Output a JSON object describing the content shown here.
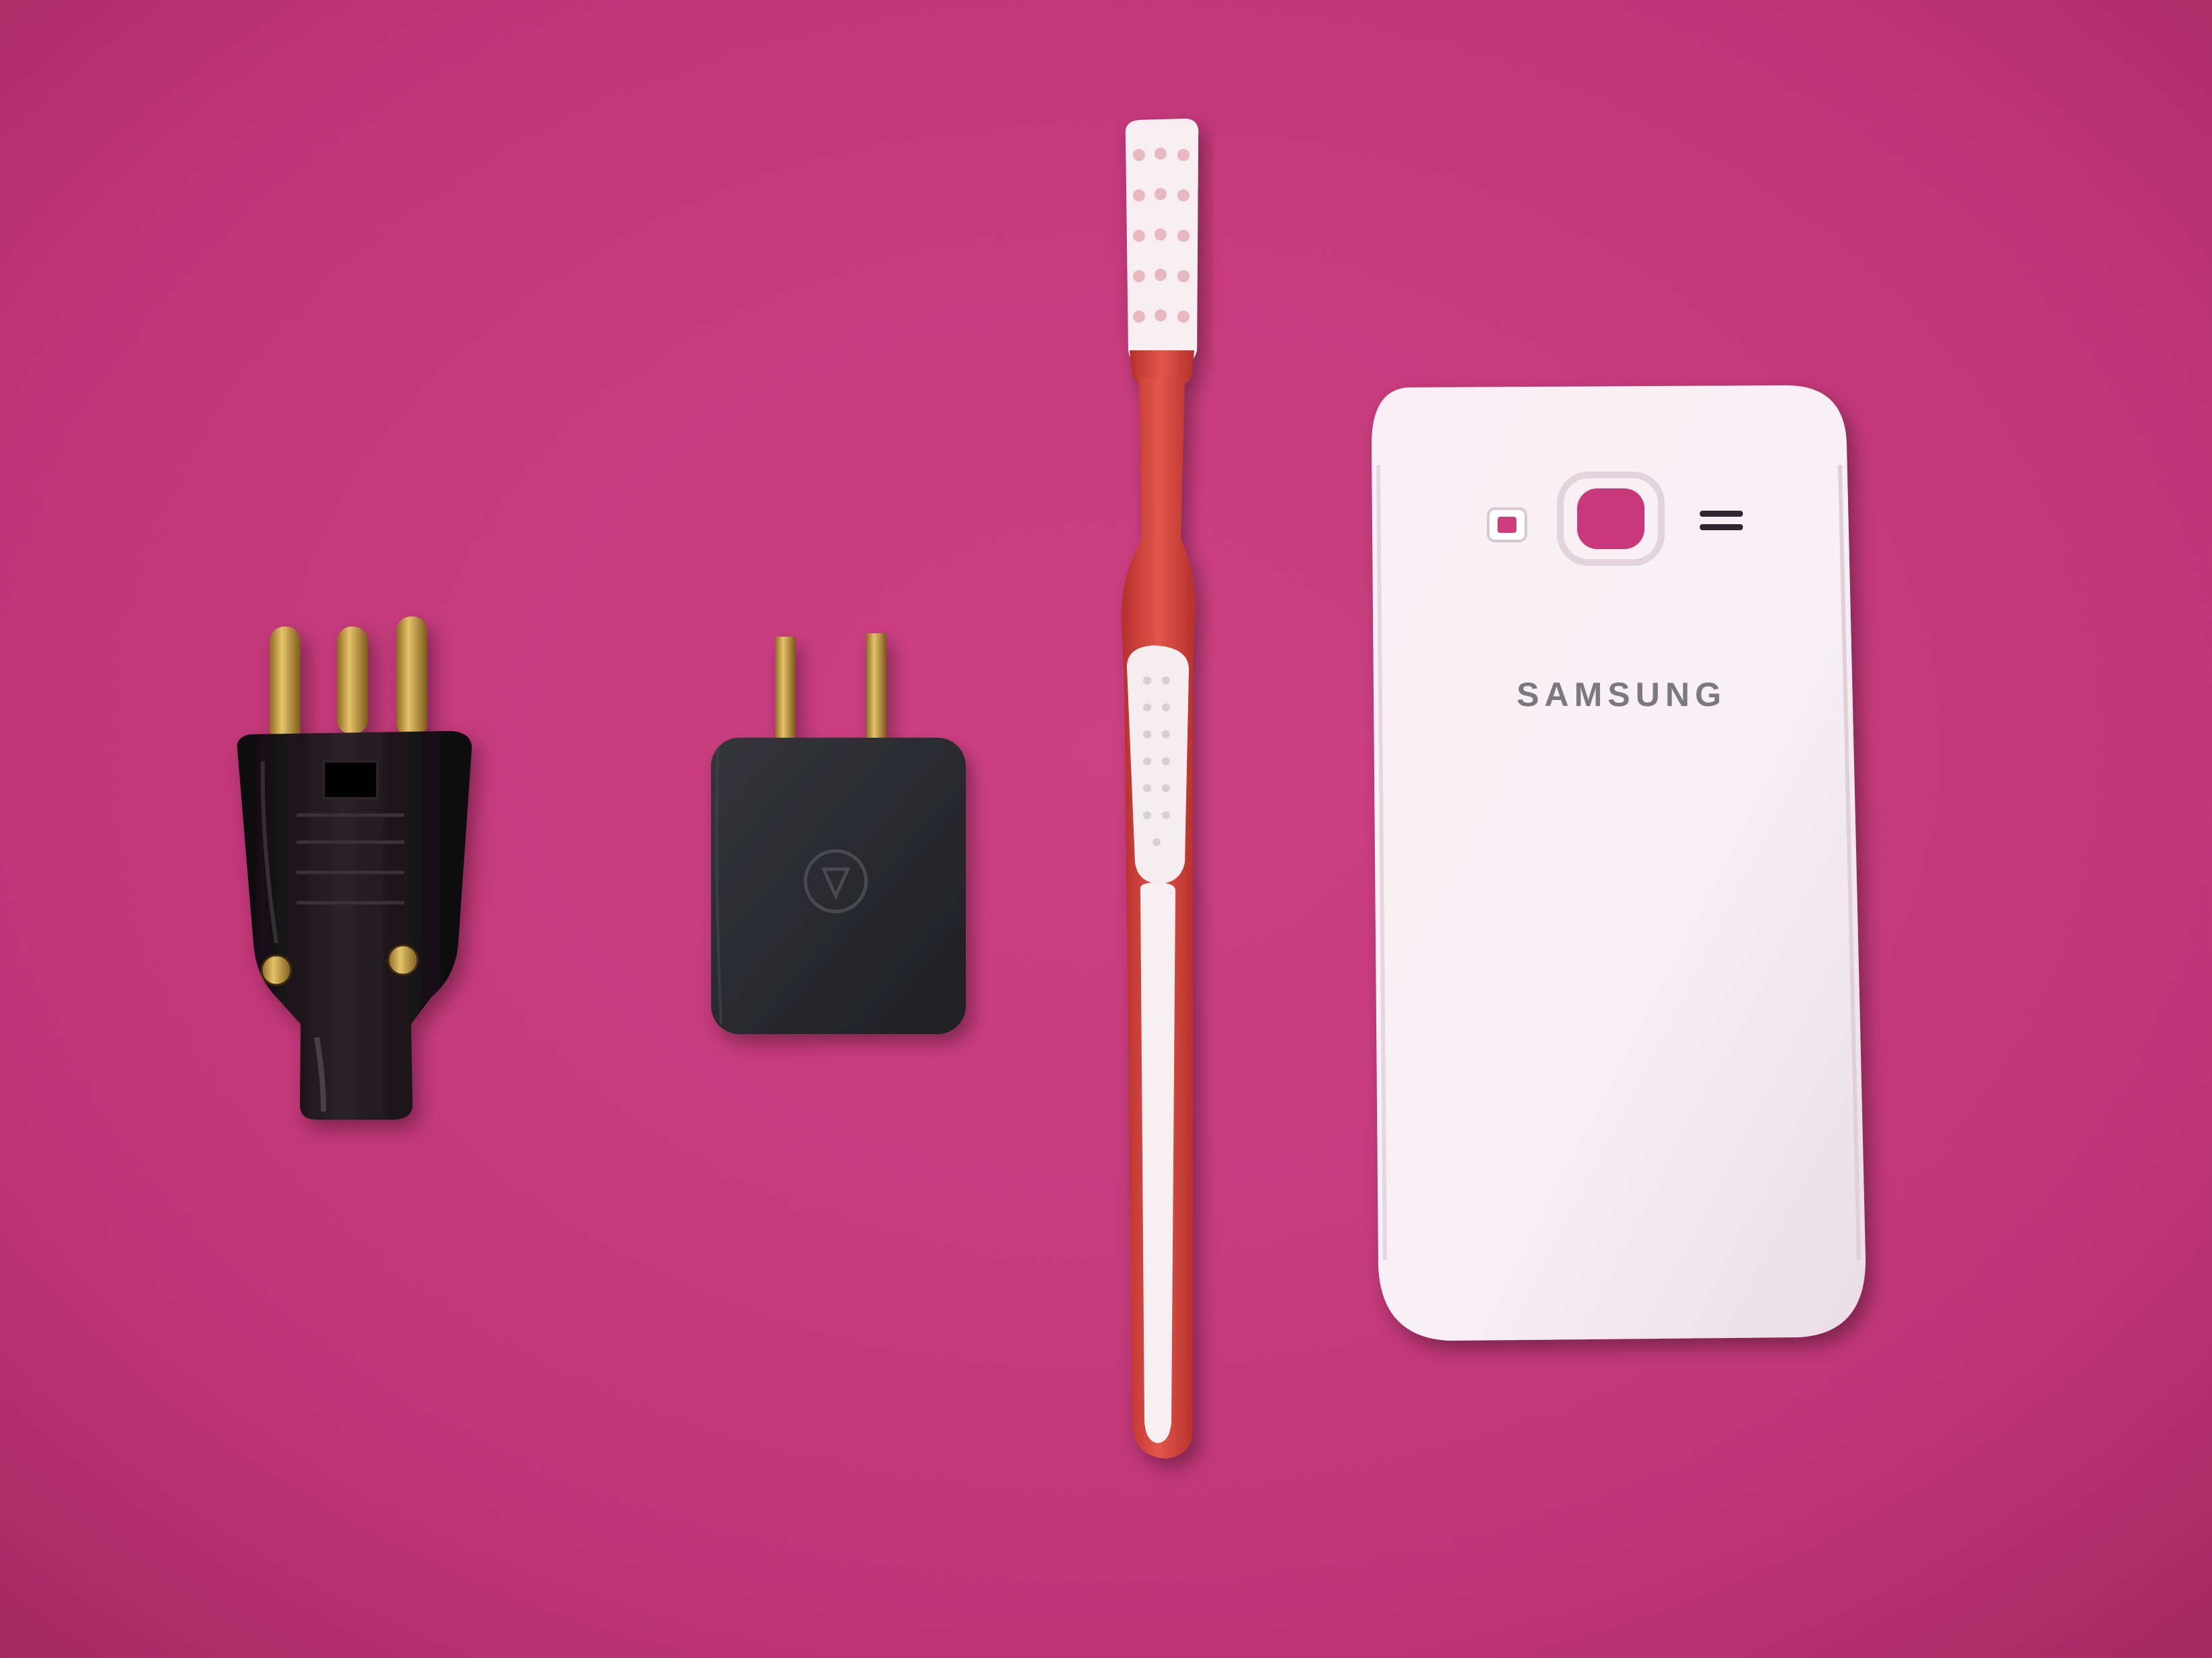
{
  "scene": {
    "objects": [
      {
        "name": "three-pin-plug"
      },
      {
        "name": "usb-power-adapter"
      },
      {
        "name": "toothbrush"
      },
      {
        "name": "phone-back-cover",
        "brand_text": "SAMSUNG"
      }
    ]
  },
  "colors": {
    "background": "#c93a7a",
    "background_dark": "#a82a62",
    "plug_body": "#141014",
    "brass": "#c8a24a",
    "adapter_body": "#2b2c30",
    "toothbrush_red": "#d8483f",
    "toothbrush_white": "#f3eef0",
    "cover_white": "#f4eef2",
    "logo_gray": "#7b7880"
  }
}
